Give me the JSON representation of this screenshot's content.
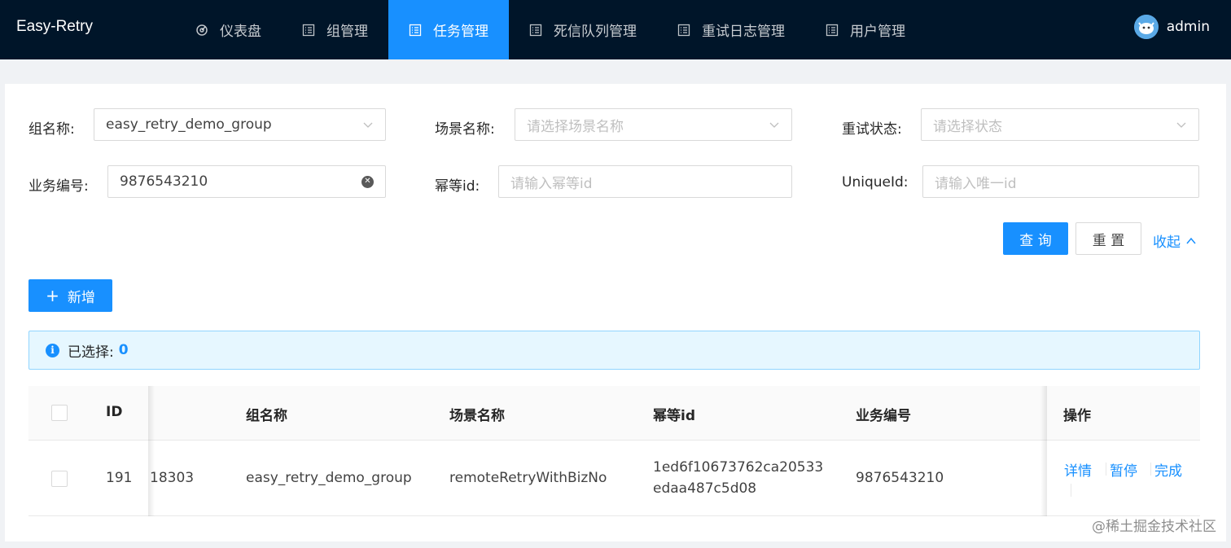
{
  "header": {
    "brand": "Easy-Retry",
    "nav": [
      {
        "label": "仪表盘",
        "icon": "dashboard-icon"
      },
      {
        "label": "组管理",
        "icon": "list-icon"
      },
      {
        "label": "任务管理",
        "icon": "list-icon",
        "active": true
      },
      {
        "label": "死信队列管理",
        "icon": "list-icon"
      },
      {
        "label": "重试日志管理",
        "icon": "list-icon"
      },
      {
        "label": "用户管理",
        "icon": "list-icon"
      }
    ],
    "user": "admin"
  },
  "filters": {
    "group_label": "组名称:",
    "group_value": "easy_retry_demo_group",
    "scene_label": "场景名称:",
    "scene_placeholder": "请选择场景名称",
    "status_label": "重试状态:",
    "status_placeholder": "请选择状态",
    "bizno_label": "业务编号:",
    "bizno_value": "9876543210",
    "idempotent_label": "幂等id:",
    "idempotent_placeholder": "请输入幂等id",
    "unique_label": "UniqueId:",
    "unique_placeholder": "请输入唯一id"
  },
  "actions": {
    "query": "查 询",
    "reset": "重 置",
    "collapse": "收起",
    "add": "新增"
  },
  "selection": {
    "label": "已选择:",
    "count": "0"
  },
  "table": {
    "columns": [
      "ID",
      "组名称",
      "场景名称",
      "幂等id",
      "业务编号",
      "操作"
    ],
    "rows": [
      {
        "id": "191",
        "hidden_cell": "18303",
        "group": "easy_retry_demo_group",
        "scene": "remoteRetryWithBizNo",
        "idempotent_line1": "1ed6f10673762ca20533",
        "idempotent_line2": "edaa487c5d08",
        "bizno": "9876543210",
        "actions": [
          "详情",
          "暂停",
          "完成"
        ]
      }
    ]
  },
  "watermark": "@稀土掘金技术社区",
  "colors": {
    "header_bg": "#001529",
    "primary": "#1890ff",
    "alert_bg": "#e6f7ff"
  }
}
